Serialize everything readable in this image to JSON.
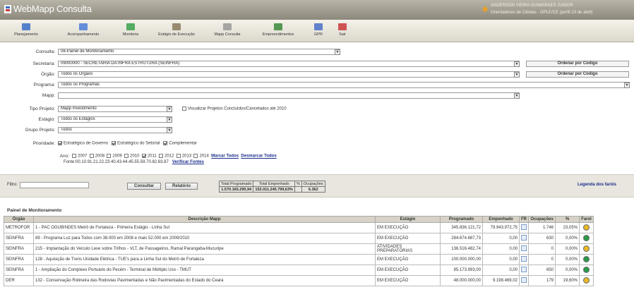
{
  "app": {
    "title": "WebMapp Consulta",
    "user_name": "ANDERSON VIEIRA GUIMARAES JUNIOR",
    "user_dept": "Orientadores de Células - GPLE/CE (perfil 23 de abril)"
  },
  "toolbar": [
    {
      "label": "Planejamento",
      "icon": "planning-icon",
      "color": "#3a6ec8"
    },
    {
      "label": "Acompanhamento",
      "icon": "tracking-icon",
      "color": "#4a7ed8"
    },
    {
      "label": "Monitoria",
      "icon": "monitor-icon",
      "color": "#3aa04a"
    },
    {
      "label": "Estágio de Execução",
      "icon": "stage-icon",
      "color": "#8a7a5a"
    },
    {
      "label": "Mapp Consulta",
      "icon": "consult-icon",
      "color": "#9a9a9a"
    },
    {
      "label": "Empreendimentos",
      "icon": "enterprise-icon",
      "color": "#3a8a3a"
    },
    {
      "label": "GPR",
      "icon": "gpr-icon",
      "color": "#4a6ec8"
    },
    {
      "label": "Sair",
      "icon": "exit-icon",
      "color": "#c83a3a"
    }
  ],
  "filters": {
    "consulta_label": "Consulta:",
    "consulta_value": "08-Painel de Monitoramento",
    "secretaria_label": "Secretaria:",
    "secretaria_value": "09000000 - SECRETARIA DA INFRA ESTRUTURA (SEINFRA)",
    "orgao_label": "Órgão:",
    "orgao_value": "Todos os Órgãos",
    "programa_label": "Programa:",
    "programa_value": "Todos os Programas",
    "mapp_label": "Mapp:",
    "mapp_value": "",
    "ordenar_label": "Ordenar por Código",
    "tipo_label": "Tipo Projeto:",
    "tipo_value": "Mapp Investimento",
    "visualizar_label": "Visualizar Projetos Concluídos/Cancelados até 2010",
    "estagio_label": "Estágio:",
    "estagio_value": "Todos os Estágios",
    "grupo_label": "Grupo Projeto:",
    "grupo_value": "Todos",
    "prioridade_label": "Prioridade:",
    "prioridades": [
      "Estratégico de Governo",
      "Estratégico do Setorial",
      "Complementar"
    ],
    "ano_label": "Ano:",
    "anos": [
      "2007",
      "2008",
      "2009",
      "2010",
      "2011",
      "2012",
      "2013",
      "2014"
    ],
    "anos_checked": [
      false,
      false,
      false,
      false,
      true,
      false,
      false,
      false
    ],
    "marcar": "Marcar Todos",
    "desmarcar": "Desmarcar Todos",
    "fontes_label": "Fonte:",
    "fontes_value": "00.10.91.21.22.23.40.43.44.45.55.59.70.82.83.87",
    "verificar": "Verificar Fontes"
  },
  "filter_bar": {
    "filtro_label": "Filtro:",
    "consultar": "Consultar",
    "relatorio": "Relatório",
    "legenda": "Legenda dos faróis",
    "totals_headers": [
      "Total Programado",
      "Total Empenhado",
      "%",
      "Ocupações"
    ],
    "totals_values": [
      "1.570.165.290,94",
      "152.011.245.799,63%",
      "",
      "6.362"
    ]
  },
  "panel": {
    "title": "Painel de Monitoramento",
    "headers": [
      "Órgão",
      "Descrição Mapp",
      "Estágio",
      "Programado",
      "Empenhado",
      "FR",
      "Ocupações",
      "%",
      "Farol"
    ],
    "rows": [
      {
        "orgao": "METROFOR",
        "descricao": "1 - PAC OGUBINDES Metrô de Fortaleza - Primeira Estágio - Linha Sul",
        "estagio": "EM EXECUÇÃO",
        "programado": "345.836.121,72",
        "empenhado": "79.943.972,75",
        "ocupacoes": "1.746",
        "pct": "23,05%",
        "farol": "#e8b82a"
      },
      {
        "orgao": "SEINFRA",
        "descricao": "89 - Programa Luz para Todos com 38.000 em 2008 e mais 52.000 em 2009/2010",
        "estagio": "EM EXECUÇÃO",
        "programado": "284.674.687,73",
        "empenhado": "0,00",
        "ocupacoes": "630",
        "pct": "0,00%",
        "farol": "#2a9a4a"
      },
      {
        "orgao": "SEINFRA",
        "descricao": "215 - Implantação do Veículo Leve sobre Trilhos - VLT, de Passageiros, Ramal Parangaba-Mucuripe",
        "estagio": "ATIVIDADES PREPARATÓRIAS",
        "programado": "136.516.482,74",
        "empenhado": "0,00",
        "ocupacoes": "0",
        "pct": "0,00%",
        "farol": "#e8b82a"
      },
      {
        "orgao": "SEINFRA",
        "descricao": "128 - Aquisição de Trens Unidade Elétrica - TUE's para a Linha Sul do Metrô de Fortaleza",
        "estagio": "EM EXECUÇÃO",
        "programado": "100.000.000,00",
        "empenhado": "0,00",
        "ocupacoes": "0",
        "pct": "0,00%",
        "farol": "#2a9a4a"
      },
      {
        "orgao": "SEINFRA",
        "descricao": "1 - Ampliação do Complexo Portuário do Pecém - Terminal de Múltiplo Uso - TMUT",
        "estagio": "EM EXECUÇÃO",
        "programado": "85.173.993,00",
        "empenhado": "0,00",
        "ocupacoes": "650",
        "pct": "0,00%",
        "farol": "#2a9a4a"
      },
      {
        "orgao": "DER",
        "descricao": "132 - Conservação Rotineira das Rodovias Pavimentadas e Não Pavimentadas do Estado do Ceará",
        "estagio": "EM EXECUÇÃO",
        "programado": "48.000.000,00",
        "empenhado": "9.198.469,02",
        "ocupacoes": "179",
        "pct": "19,60%",
        "farol": "#e8b82a"
      }
    ]
  }
}
